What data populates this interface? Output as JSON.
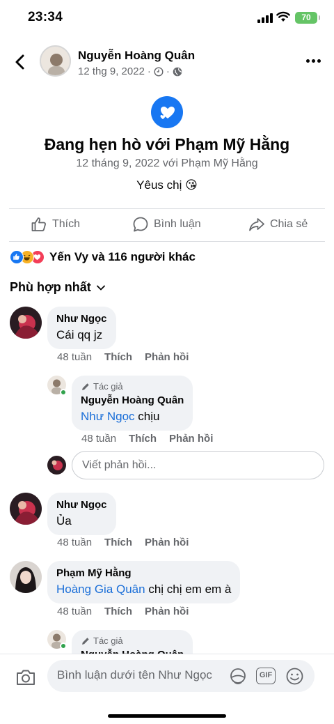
{
  "status_bar": {
    "time": "23:34",
    "battery": "70"
  },
  "header": {
    "author": "Nguyễn Hoàng Quân",
    "date": "12 thg 9, 2022"
  },
  "event": {
    "title": "Đang hẹn hò với Phạm Mỹ Hằng",
    "subtitle": "12 tháng 9, 2022 với Phạm Mỹ Hằng",
    "caption": "Yêus chị 😘"
  },
  "actions": {
    "like": "Thích",
    "comment": "Bình luận",
    "share": "Chia sẻ"
  },
  "reactions": {
    "summary": "Yến Vy và 116 người khác"
  },
  "sort": {
    "label": "Phù hợp nhất"
  },
  "comments": [
    {
      "name": "Như Ngọc",
      "text": "Cái qq jz",
      "time": "48 tuần",
      "like": "Thích",
      "reply": "Phản hồi"
    },
    {
      "author_tag": "Tác giả",
      "name": "Nguyễn Hoàng Quân",
      "mention": "Như Ngọc",
      "text": " chịu",
      "time": "48 tuần",
      "like": "Thích",
      "reply": "Phản hồi"
    },
    {
      "name": "Như Ngọc",
      "text": "Ủa",
      "time": "48 tuần",
      "like": "Thích",
      "reply": "Phản hồi"
    },
    {
      "name": "Phạm Mỹ Hằng",
      "mention": "Hoàng Gia Quân",
      "text": " chị chị em em à",
      "time": "48 tuần",
      "like": "Thích",
      "reply": "Phản hồi"
    },
    {
      "author_tag": "Tác giả",
      "name": "Nguyễn Hoàng Quân"
    }
  ],
  "reply_box": {
    "placeholder": "Viết phản hồi..."
  },
  "composer": {
    "placeholder": "Bình luận dưới tên Như Ngọc"
  },
  "colors": {
    "accent": "#1877f2",
    "mention": "#1a6ed8",
    "bubble": "#f0f2f5",
    "muted": "#65676b"
  }
}
